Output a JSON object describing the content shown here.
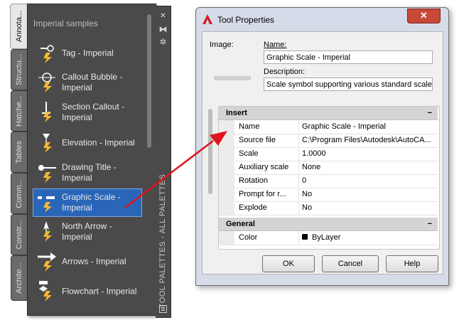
{
  "palette": {
    "section_title": "Imperial samples",
    "strip_title": "TOOL PALETTES - ALL PALETTES",
    "tabs": [
      "Annota...",
      "Structu...",
      "Hatche...",
      "Tables",
      "Comm...",
      "Constr...",
      "Archite..."
    ],
    "tools": [
      {
        "label": "Tag - Imperial"
      },
      {
        "label": "Callout Bubble - Imperial"
      },
      {
        "label": "Section Callout - Imperial"
      },
      {
        "label": "Elevation - Imperial"
      },
      {
        "label": "Drawing Title - Imperial"
      },
      {
        "label": "Graphic Scale - Imperial"
      },
      {
        "label": "North Arrow - Imperial"
      },
      {
        "label": "Arrows - Imperial"
      },
      {
        "label": "Flowchart - Imperial"
      }
    ],
    "strip_icons": {
      "close": "×",
      "auto_hide": "⧓",
      "properties": "✲"
    }
  },
  "dialog": {
    "title": "Tool Properties",
    "close": "✕",
    "image_label": "Image:",
    "name_label": "Name:",
    "name_value": "Graphic Scale - Imperial",
    "description_label": "Description:",
    "description_value": "Scale symbol supporting various standard scales",
    "insert": {
      "title": "Insert",
      "toggle": "−",
      "rows": [
        {
          "name": "Name",
          "value": "Graphic Scale - Imperial"
        },
        {
          "name": "Source file",
          "value": "C:\\Program Files\\Autodesk\\AutoCA..."
        },
        {
          "name": "Scale",
          "value": "1.0000"
        },
        {
          "name": "Auxiliary scale",
          "value": "None"
        },
        {
          "name": "Rotation",
          "value": "0"
        },
        {
          "name": "Prompt for r...",
          "value": "No"
        },
        {
          "name": "Explode",
          "value": "No"
        }
      ]
    },
    "general": {
      "title": "General",
      "toggle": "−",
      "rows": [
        {
          "name": "Color",
          "value": "ByLayer"
        }
      ]
    },
    "buttons": {
      "ok": "OK",
      "cancel": "Cancel",
      "help": "Help"
    }
  },
  "colors": {
    "arrow": "#e0141e",
    "selection": "#2a66b8",
    "close_button": "#c94838"
  }
}
